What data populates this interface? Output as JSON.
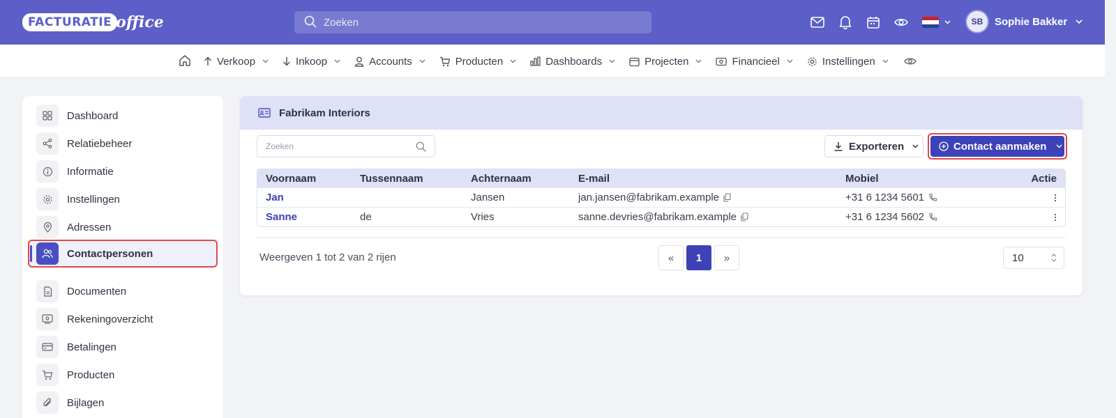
{
  "brand": {
    "logo_word": "FACTURATIE",
    "logo_suffix": "office"
  },
  "topbar": {
    "search_placeholder": "Zoeken",
    "icons": [
      "mail-icon",
      "bell-icon",
      "calendar-icon",
      "eye-icon",
      "flag-nl-icon"
    ],
    "user_initials": "SB",
    "user_name": "Sophie Bakker"
  },
  "nav": {
    "items": [
      {
        "label": "Verkoop",
        "icon": "arrow-up-icon"
      },
      {
        "label": "Inkoop",
        "icon": "arrow-down-icon"
      },
      {
        "label": "Accounts",
        "icon": "user-icon"
      },
      {
        "label": "Producten",
        "icon": "cart-icon"
      },
      {
        "label": "Dashboards",
        "icon": "bar-chart-icon"
      },
      {
        "label": "Projecten",
        "icon": "calendar-icon"
      },
      {
        "label": "Financieel",
        "icon": "money-icon"
      },
      {
        "label": "Instellingen",
        "icon": "gear-icon"
      }
    ]
  },
  "sidebar": {
    "items": [
      {
        "label": "Dashboard",
        "icon": "grid-icon"
      },
      {
        "label": "Relatiebeheer",
        "icon": "share-icon"
      },
      {
        "label": "Informatie",
        "icon": "info-icon"
      },
      {
        "label": "Instellingen",
        "icon": "gear-icon"
      },
      {
        "label": "Adressen",
        "icon": "map-pin-icon"
      },
      {
        "label": "Contactpersonen",
        "icon": "users-icon",
        "active": true
      },
      {
        "label": "Documenten",
        "icon": "document-icon"
      },
      {
        "label": "Rekeningoverzicht",
        "icon": "account-statement-icon"
      },
      {
        "label": "Betalingen",
        "icon": "credit-card-icon"
      },
      {
        "label": "Producten",
        "icon": "cart-icon"
      },
      {
        "label": "Bijlagen",
        "icon": "paperclip-icon"
      }
    ]
  },
  "card": {
    "title": "Fabrikam Interiors",
    "search_placeholder": "Zoeken",
    "export_label": "Exporteren",
    "create_label": "Contact aanmaken"
  },
  "table": {
    "headers": [
      "Voornaam",
      "Tussennaam",
      "Achternaam",
      "E-mail",
      "Mobiel",
      "Actie"
    ],
    "rows": [
      {
        "first": "Jan",
        "middle": "",
        "last": "Jansen",
        "email": "jan.jansen@fabrikam.example",
        "mobile": "+31 6 1234 5601"
      },
      {
        "first": "Sanne",
        "middle": "de",
        "last": "Vries",
        "email": "sanne.devries@fabrikam.example",
        "mobile": "+31 6 1234 5602"
      }
    ]
  },
  "pagination": {
    "info": "Weergeven 1 tot 2 van 2 rijen",
    "prev": "«",
    "current": "1",
    "next": "»",
    "page_size": "10"
  },
  "colors": {
    "primary": "#5b5fc7",
    "accent": "#3d42b8",
    "highlight": "#e04848"
  }
}
